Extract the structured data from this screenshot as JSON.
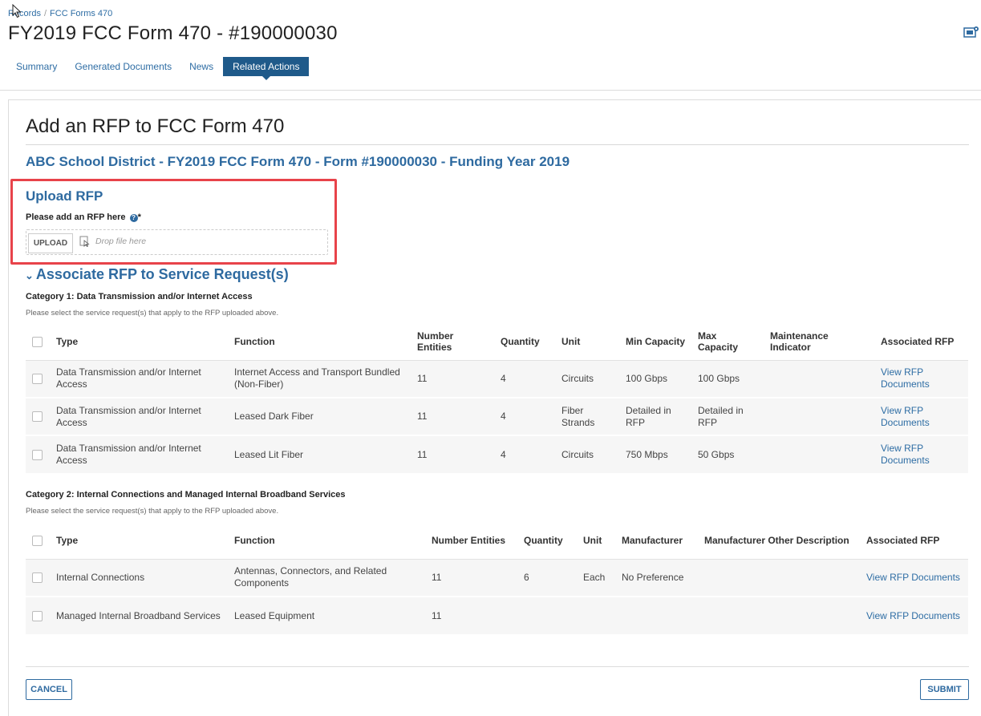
{
  "breadcrumb": {
    "records": "Records",
    "sep": "/",
    "forms": "FCC Forms 470"
  },
  "page_title": "FY2019 FCC Form 470 - #190000030",
  "tabs": [
    {
      "label": "Summary",
      "active": false
    },
    {
      "label": "Generated Documents",
      "active": false
    },
    {
      "label": "News",
      "active": false
    },
    {
      "label": "Related Actions",
      "active": true
    }
  ],
  "heading": "Add an RFP to FCC Form 470",
  "district_title": "ABC School District - FY2019 FCC Form 470 - Form #190000030 - Funding Year 2019",
  "upload": {
    "title": "Upload RFP",
    "label": "Please add an RFP here",
    "required_marker": "*",
    "button": "UPLOAD",
    "drop_placeholder": "Drop file here"
  },
  "associate_title": "Associate RFP to Service Request(s)",
  "category1": {
    "title": "Category 1: Data Transmission and/or Internet Access",
    "hint": "Please select the service request(s) that apply to the RFP uploaded above.",
    "headers": [
      "Type",
      "Function",
      "Number Entities",
      "Quantity",
      "Unit",
      "Min Capacity",
      "Max Capacity",
      "Maintenance Indicator",
      "Associated RFP"
    ],
    "rows": [
      {
        "type": "Data Transmission and/or Internet Access",
        "function": "Internet Access and Transport Bundled (Non-Fiber)",
        "entities": "11",
        "quantity": "4",
        "unit": "Circuits",
        "min": "100 Gbps",
        "max": "100 Gbps",
        "maint": "",
        "rfp": "View RFP Documents"
      },
      {
        "type": "Data Transmission and/or Internet Access",
        "function": "Leased Dark Fiber",
        "entities": "11",
        "quantity": "4",
        "unit": "Fiber Strands",
        "min": "Detailed in RFP",
        "max": "Detailed in RFP",
        "maint": "",
        "rfp": "View RFP Documents"
      },
      {
        "type": "Data Transmission and/or Internet Access",
        "function": "Leased Lit Fiber",
        "entities": "11",
        "quantity": "4",
        "unit": "Circuits",
        "min": "750 Mbps",
        "max": "50 Gbps",
        "maint": "",
        "rfp": "View RFP Documents"
      }
    ]
  },
  "category2": {
    "title": "Category 2: Internal Connections and Managed Internal Broadband Services",
    "hint": "Please select the service request(s) that apply to the RFP uploaded above.",
    "headers": [
      "Type",
      "Function",
      "Number Entities",
      "Quantity",
      "Unit",
      "Manufacturer",
      "Manufacturer Other Description",
      "Associated RFP"
    ],
    "rows": [
      {
        "type": "Internal Connections",
        "function": "Antennas, Connectors, and Related Components",
        "entities": "11",
        "quantity": "6",
        "unit": "Each",
        "manufacturer": "No Preference",
        "other": "",
        "rfp": "View RFP Documents"
      },
      {
        "type": "Managed Internal Broadband Services",
        "function": "Leased Equipment",
        "entities": "11",
        "quantity": "",
        "unit": "",
        "manufacturer": "",
        "other": "",
        "rfp": "View RFP Documents"
      }
    ]
  },
  "buttons": {
    "cancel": "CANCEL",
    "submit": "SUBMIT"
  },
  "colors": {
    "accent": "#2e6aa0",
    "active_tab": "#1f5a8a",
    "highlight_box": "#e8434a"
  }
}
